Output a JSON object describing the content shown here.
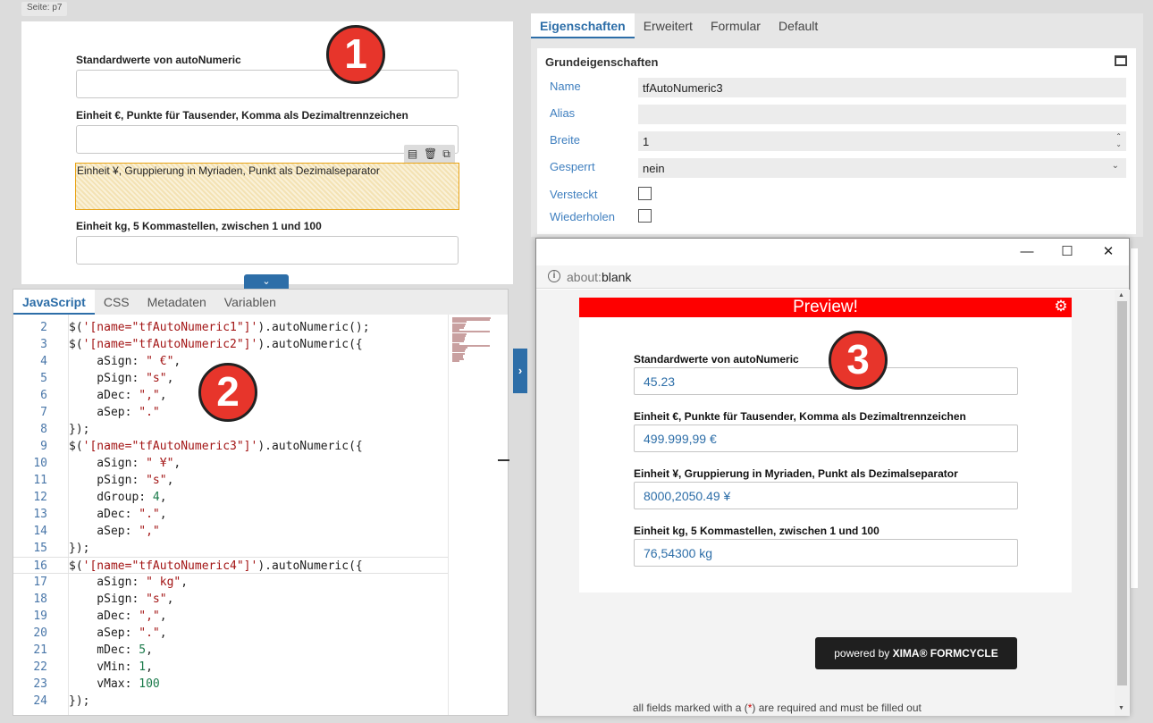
{
  "canvas": {
    "page_tab": "Seite: p7",
    "fields": [
      {
        "label": "Standardwerte von autoNumeric"
      },
      {
        "label": "Einheit €, Punkte für Tausender, Komma als Dezimaltrennzeichen"
      },
      {
        "label": "Einheit ¥, Gruppierung in Myriaden, Punkt als Dezimalseparator"
      },
      {
        "label": "Einheit kg, 5 Kommastellen, zwischen 1 und 100"
      }
    ],
    "collapse_icon": "chevron-down-icon"
  },
  "badges": {
    "one": "1",
    "two": "2",
    "three": "3"
  },
  "editor": {
    "tabs": [
      "JavaScript",
      "CSS",
      "Metadaten",
      "Variablen"
    ],
    "active_tab": "JavaScript",
    "lines": [
      {
        "n": "2",
        "code": "$('[name=\"tfAutoNumeric1\"]').autoNumeric();"
      },
      {
        "n": "3",
        "code": "$('[name=\"tfAutoNumeric2\"]').autoNumeric({"
      },
      {
        "n": "4",
        "code": "    aSign: \" €\","
      },
      {
        "n": "5",
        "code": "    pSign: \"s\","
      },
      {
        "n": "6",
        "code": "    aDec: \",\","
      },
      {
        "n": "7",
        "code": "    aSep: \".\""
      },
      {
        "n": "8",
        "code": "});"
      },
      {
        "n": "9",
        "code": "$('[name=\"tfAutoNumeric3\"]').autoNumeric({"
      },
      {
        "n": "10",
        "code": "    aSign: \" ¥\","
      },
      {
        "n": "11",
        "code": "    pSign: \"s\","
      },
      {
        "n": "12",
        "code": "    dGroup: 4,"
      },
      {
        "n": "13",
        "code": "    aDec: \".\","
      },
      {
        "n": "14",
        "code": "    aSep: \",\""
      },
      {
        "n": "15",
        "code": "});"
      },
      {
        "n": "16",
        "code": "$('[name=\"tfAutoNumeric4\"]').autoNumeric({"
      },
      {
        "n": "17",
        "code": "    aSign: \" kg\","
      },
      {
        "n": "18",
        "code": "    pSign: \"s\","
      },
      {
        "n": "19",
        "code": "    aDec: \",\","
      },
      {
        "n": "20",
        "code": "    aSep: \".\","
      },
      {
        "n": "21",
        "code": "    mDec: 5,"
      },
      {
        "n": "22",
        "code": "    vMin: 1,"
      },
      {
        "n": "23",
        "code": "    vMax: 100"
      },
      {
        "n": "24",
        "code": "});"
      }
    ]
  },
  "properties": {
    "tabs": [
      "Eigenschaften",
      "Erweitert",
      "Formular",
      "Default"
    ],
    "active_tab": "Eigenschaften",
    "section_title": "Grundeigenschaften",
    "name_label": "Name",
    "name_value": "tfAutoNumeric3",
    "alias_label": "Alias",
    "alias_value": "",
    "width_label": "Breite",
    "width_value": "1",
    "locked_label": "Gesperrt",
    "locked_value": "nein",
    "hidden_label": "Versteckt",
    "repeat_label": "Wiederholen"
  },
  "preview": {
    "address_scheme": "about:",
    "address_path": "blank",
    "banner": "Preview!",
    "fields": [
      {
        "label": "Standardwerte von autoNumeric",
        "value": "45.23"
      },
      {
        "label": "Einheit €, Punkte für Tausender, Komma als Dezimaltrennzeichen",
        "value": "499.999,99 €"
      },
      {
        "label": "Einheit ¥, Gruppierung in Myriaden, Punkt als Dezimalseparator",
        "value": "8000,2050.49 ¥"
      },
      {
        "label": "Einheit kg, 5 Kommastellen, zwischen 1 und 100",
        "value": "76,54300 kg"
      }
    ],
    "powered_prefix": "powered by ",
    "powered_brand": "XIMA® FORMCYCLE",
    "required_pre": "all fields marked with a (",
    "required_star": "*",
    "required_post": ") are required and must be filled out"
  },
  "colors": {
    "accent": "#2d6ea8",
    "banner": "#fe0000",
    "selected_border": "#e8a316",
    "badge": "#e7352b"
  }
}
